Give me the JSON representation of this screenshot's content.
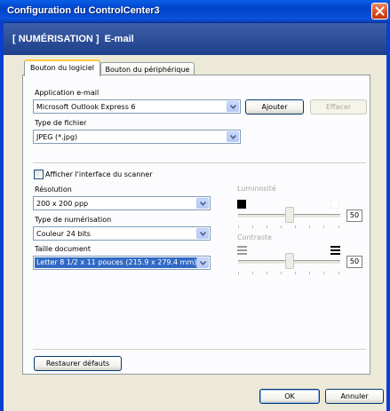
{
  "window": {
    "title": "Configuration du ControlCenter3",
    "header": "[ NUMÉRISATION ]  E-mail"
  },
  "tabs": [
    {
      "label": "Bouton du logiciel",
      "active": true
    },
    {
      "label": "Bouton du périphérique",
      "active": false
    }
  ],
  "email_app": {
    "label": "Application e-mail",
    "value": "Microsoft Outlook Express 6",
    "add_label": "Ajouter",
    "delete_label": "Effacer"
  },
  "file_type": {
    "label": "Type de fichier",
    "value": "JPEG (*.jpg)"
  },
  "scanner_interface": {
    "label": "Afficher l'interface du scanner",
    "checked": false
  },
  "resolution": {
    "label": "Résolution",
    "value": "200 x 200 ppp"
  },
  "scan_type": {
    "label": "Type de numérisation",
    "value": "Couleur 24 bits"
  },
  "document_size": {
    "label": "Taille document",
    "value": "Letter 8 1/2 x 11 pouces (215.9 x 279.4 mm)"
  },
  "brightness": {
    "label": "Luminosité",
    "value": "50",
    "level": 0.5
  },
  "contrast": {
    "label": "Contraste",
    "value": "50",
    "level": 0.5
  },
  "restore_label": "Restaurer défauts",
  "ok_label": "OK",
  "cancel_label": "Annuler",
  "colors": {
    "title_blue": "#0a52dd",
    "header_blue": "#1e3f8a",
    "selection": "#316ac5"
  }
}
